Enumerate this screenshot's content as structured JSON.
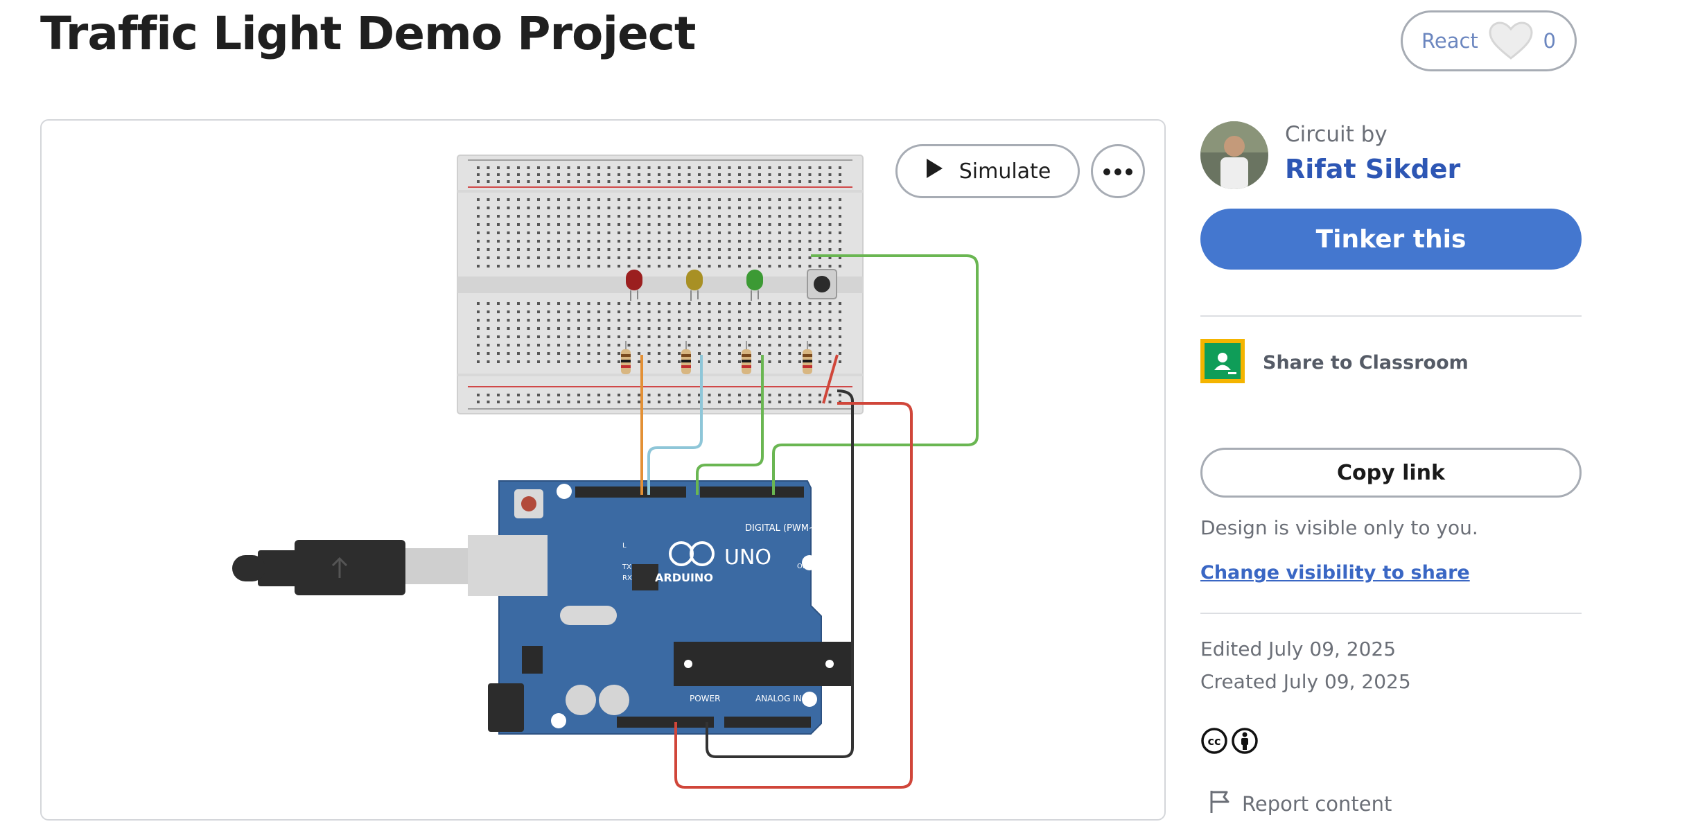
{
  "page": {
    "title": "Traffic Light Demo Project"
  },
  "react": {
    "label": "React",
    "count": "0"
  },
  "canvas": {
    "simulate_label": "Simulate",
    "board_labels": {
      "digital": "DIGITAL (PWM~)",
      "brand": "ARDUINO",
      "model": "UNO",
      "power": "POWER",
      "analog": "ANALOG IN",
      "on": "ON",
      "tx": "TX",
      "rx": "RX",
      "l": "L"
    }
  },
  "author": {
    "prefix": "Circuit by",
    "name": "Rifat Sikder"
  },
  "actions": {
    "tinker_label": "Tinker this",
    "classroom_label": "Share to Classroom",
    "copy_link_label": "Copy link",
    "visibility_note": "Design is visible only to you.",
    "change_visibility_label": "Change visibility to share",
    "edited": "Edited July 09, 2025",
    "created": "Created July 09, 2025",
    "report_label": "Report content"
  },
  "colors": {
    "primary": "#4477cf",
    "link": "#2d56b4",
    "board": "#3b6aa3",
    "wire_orange": "#e39035",
    "wire_blue": "#8ec6d8",
    "wire_green": "#6ab652",
    "wire_red": "#d0463a",
    "wire_black": "#333333"
  }
}
